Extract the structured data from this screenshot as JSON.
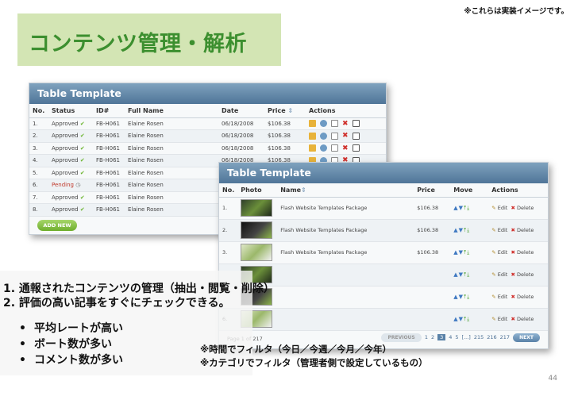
{
  "header": {
    "note": "※これらは実装イメージです。",
    "title": "コンテンツ管理・解析"
  },
  "table1": {
    "title": "Table Template",
    "columns": [
      "No.",
      "Status",
      "ID#",
      "Full Name",
      "Date",
      "Price",
      "Actions"
    ],
    "rows": [
      {
        "no": "1.",
        "status": "Approved",
        "id": "FB-H061",
        "name": "Elaine Rosen",
        "date": "06/18/2008",
        "price": "$106.38"
      },
      {
        "no": "2.",
        "status": "Approved",
        "id": "FB-H061",
        "name": "Elaine Rosen",
        "date": "06/18/2008",
        "price": "$106.38"
      },
      {
        "no": "3.",
        "status": "Approved",
        "id": "FB-H061",
        "name": "Elaine Rosen",
        "date": "06/18/2008",
        "price": "$106.38"
      },
      {
        "no": "4.",
        "status": "Approved",
        "id": "FB-H061",
        "name": "Elaine Rosen",
        "date": "06/18/2008",
        "price": "$106.38"
      },
      {
        "no": "5.",
        "status": "Approved",
        "id": "FB-H061",
        "name": "Elaine Rosen",
        "date": "06/18/2008",
        "price": "$106.38"
      },
      {
        "no": "6.",
        "status": "Pending",
        "id": "FB-H061",
        "name": "Elaine Rosen",
        "date": "",
        "price": ""
      },
      {
        "no": "7.",
        "status": "Approved",
        "id": "FB-H061",
        "name": "Elaine Rosen",
        "date": "",
        "price": ""
      },
      {
        "no": "8.",
        "status": "Approved",
        "id": "FB-H061",
        "name": "Elaine Rosen",
        "date": "",
        "price": ""
      }
    ],
    "add_new": "ADD NEW"
  },
  "table2": {
    "title": "Table Template",
    "columns": [
      "No.",
      "Photo",
      "Name",
      "Price",
      "Move",
      "Actions"
    ],
    "rows": [
      {
        "no": "1.",
        "name": "Flash Website Templates Package",
        "price": "$106.38",
        "edit": "Edit",
        "delete": "Delete"
      },
      {
        "no": "2.",
        "name": "Flash Website Templates Package",
        "price": "$106.38",
        "edit": "Edit",
        "delete": "Delete"
      },
      {
        "no": "3.",
        "name": "Flash Website Templates Package",
        "price": "$106.38",
        "edit": "Edit",
        "delete": "Delete"
      },
      {
        "no": "",
        "name": "",
        "price": "",
        "edit": "Edit",
        "delete": "Delete"
      },
      {
        "no": "",
        "name": "",
        "price": "",
        "edit": "Edit",
        "delete": "Delete"
      },
      {
        "no": "6.",
        "name": "",
        "price": "",
        "edit": "Edit",
        "delete": "Delete"
      }
    ],
    "pager": {
      "info": "Page 1 of 217",
      "previous": "PREVIOUS",
      "pages": [
        "1",
        "2",
        "3",
        "4",
        "5",
        "[...]",
        "215",
        "216",
        "217"
      ],
      "current": "3",
      "next": "NEXT"
    }
  },
  "content": {
    "item1": "1. 通報されたコンテンツの管理（抽出・閲覧・削除）",
    "item2": "2. 評価の高い記事をすぐにチェックできる。",
    "bullets": [
      "平均レートが高い",
      "ボート数が多い",
      "コメント数が多い"
    ],
    "note1": "※時間でフィルタ（今日／今週／今月／今年）",
    "note2": "※カテゴリでフィルタ（管理者側で設定しているもの）",
    "page_number": "44"
  },
  "colors": {
    "accent_green": "#3c8f2f",
    "title_band": "#d3e5b4",
    "table_header": "#5a82a8"
  }
}
